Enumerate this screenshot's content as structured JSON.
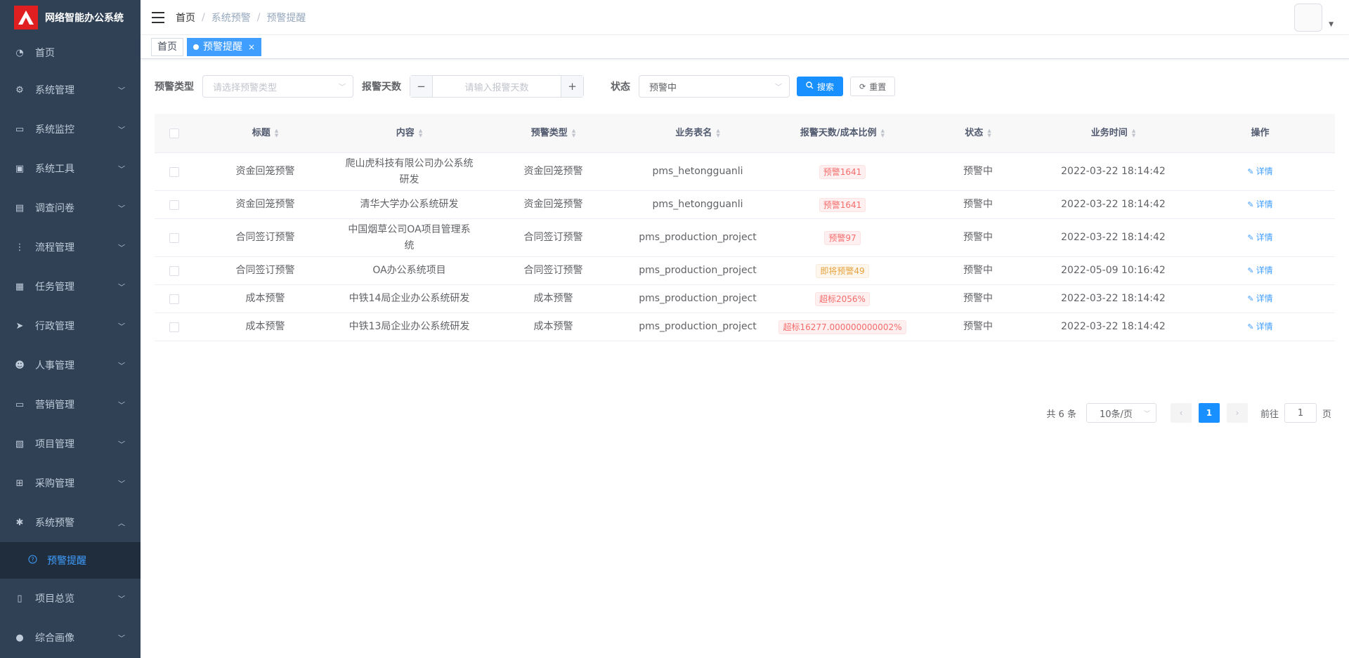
{
  "brand": {
    "title": "网络智能办公系统"
  },
  "sidebar": {
    "items": [
      {
        "label": "首页",
        "icon": "dashboard-icon"
      },
      {
        "label": "系统管理",
        "icon": "gear-icon"
      },
      {
        "label": "系统监控",
        "icon": "monitor-icon"
      },
      {
        "label": "系统工具",
        "icon": "toolbox-icon"
      },
      {
        "label": "调查问卷",
        "icon": "message-icon"
      },
      {
        "label": "流程管理",
        "icon": "flow-icon"
      },
      {
        "label": "任务管理",
        "icon": "task-icon"
      },
      {
        "label": "行政管理",
        "icon": "send-icon"
      },
      {
        "label": "人事管理",
        "icon": "people-icon"
      },
      {
        "label": "营销管理",
        "icon": "chart-monitor-icon"
      },
      {
        "label": "项目管理",
        "icon": "project-icon"
      },
      {
        "label": "采购管理",
        "icon": "cart-icon"
      },
      {
        "label": "系统预警",
        "icon": "bug-icon"
      },
      {
        "label": "项目总览",
        "icon": "book-icon"
      },
      {
        "label": "综合画像",
        "icon": "user-icon"
      }
    ],
    "submenu": {
      "label": "预警提醒",
      "icon": "question-circle-icon"
    }
  },
  "breadcrumb": {
    "home": "首页",
    "level1": "系统预警",
    "level2": "预警提醒"
  },
  "tags": {
    "home": "首页",
    "active": "预警提醒",
    "close": "×"
  },
  "filters": {
    "type_label": "预警类型",
    "type_placeholder": "请选择预警类型",
    "days_label": "报警天数",
    "days_placeholder": "请输入报警天数",
    "days_minus": "−",
    "days_plus": "+",
    "status_label": "状态",
    "status_value": "预警中",
    "search_label": "搜索",
    "reset_label": "重置"
  },
  "table": {
    "columns": [
      "标题",
      "内容",
      "预警类型",
      "业务表名",
      "报警天数/成本比例",
      "状态",
      "业务时间",
      "操作"
    ],
    "rows": [
      {
        "title": "资金回笼预警",
        "content": "爬山虎科技有限公司办公系统研发",
        "type": "资金回笼预警",
        "table": "pms_hetongguanli",
        "alarm": "预警1641",
        "alarm_level": "danger",
        "status": "预警中",
        "time": "2022-03-22 18:14:42",
        "action": "详情"
      },
      {
        "title": "资金回笼预警",
        "content": "清华大学办公系统研发",
        "type": "资金回笼预警",
        "table": "pms_hetongguanli",
        "alarm": "预警1641",
        "alarm_level": "danger",
        "status": "预警中",
        "time": "2022-03-22 18:14:42",
        "action": "详情"
      },
      {
        "title": "合同签订预警",
        "content": "中国烟草公司OA项目管理系统",
        "type": "合同签订预警",
        "table": "pms_production_project",
        "alarm": "预警97",
        "alarm_level": "danger",
        "status": "预警中",
        "time": "2022-03-22 18:14:42",
        "action": "详情"
      },
      {
        "title": "合同签订预警",
        "content": "OA办公系统项目",
        "type": "合同签订预警",
        "table": "pms_production_project",
        "alarm": "即将预警49",
        "alarm_level": "warning",
        "status": "预警中",
        "time": "2022-05-09 10:16:42",
        "action": "详情"
      },
      {
        "title": "成本预警",
        "content": "中铁14局企业办公系统研发",
        "type": "成本预警",
        "table": "pms_production_project",
        "alarm": "超标2056%",
        "alarm_level": "danger",
        "status": "预警中",
        "time": "2022-03-22 18:14:42",
        "action": "详情"
      },
      {
        "title": "成本预警",
        "content": "中铁13局企业办公系统研发",
        "type": "成本预警",
        "table": "pms_production_project",
        "alarm": "超标16277.000000000002%",
        "alarm_level": "danger",
        "status": "预警中",
        "time": "2022-03-22 18:14:42",
        "action": "详情"
      }
    ]
  },
  "pagination": {
    "total": "共 6 条",
    "page_size": "10条/页",
    "current": "1",
    "goto_prefix": "前往",
    "goto_value": "1",
    "goto_suffix": "页"
  },
  "colors": {
    "sidebar_bg": "#304156",
    "primary": "#1890ff",
    "danger": "#f56c6c",
    "warning": "#e6a23c"
  }
}
